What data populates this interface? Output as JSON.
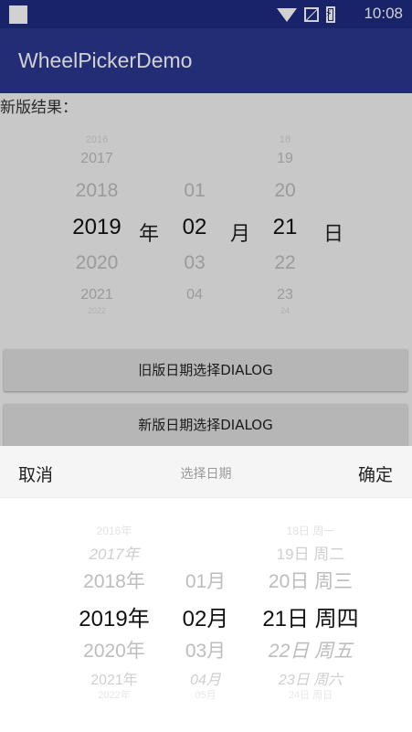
{
  "status_bar": {
    "time": "10:08"
  },
  "app_bar": {
    "title": "WheelPickerDemo"
  },
  "content": {
    "result_label": "新版结果：",
    "inline_picker": {
      "years": [
        "2016",
        "2017",
        "2018",
        "2019",
        "2020",
        "2021",
        "2022"
      ],
      "months": [
        "01",
        "02",
        "03",
        "04"
      ],
      "days": [
        "18",
        "19",
        "20",
        "21",
        "22",
        "23",
        "24"
      ],
      "selected": {
        "year": "2019",
        "month": "02",
        "day": "21"
      },
      "units": {
        "year": "年",
        "month": "月",
        "day": "日"
      }
    },
    "buttons": {
      "old_dialog": "旧版日期选择DIALOG",
      "new_dialog": "新版日期选择DIALOG"
    }
  },
  "dialog": {
    "cancel": "取消",
    "title": "选择日期",
    "confirm": "确定",
    "years": [
      "2016年",
      "2017年",
      "2018年",
      "2019年",
      "2020年",
      "2021年",
      "2022年"
    ],
    "months": [
      "01月",
      "02月",
      "03月",
      "04月",
      "05月"
    ],
    "days": [
      "18日 周一",
      "19日 周二",
      "20日 周三",
      "21日 周四",
      "22日 周五",
      "23日 周六",
      "24日 周日"
    ]
  },
  "colors": {
    "status_bar": "#1e2b80",
    "app_bar": "#2b3791"
  }
}
